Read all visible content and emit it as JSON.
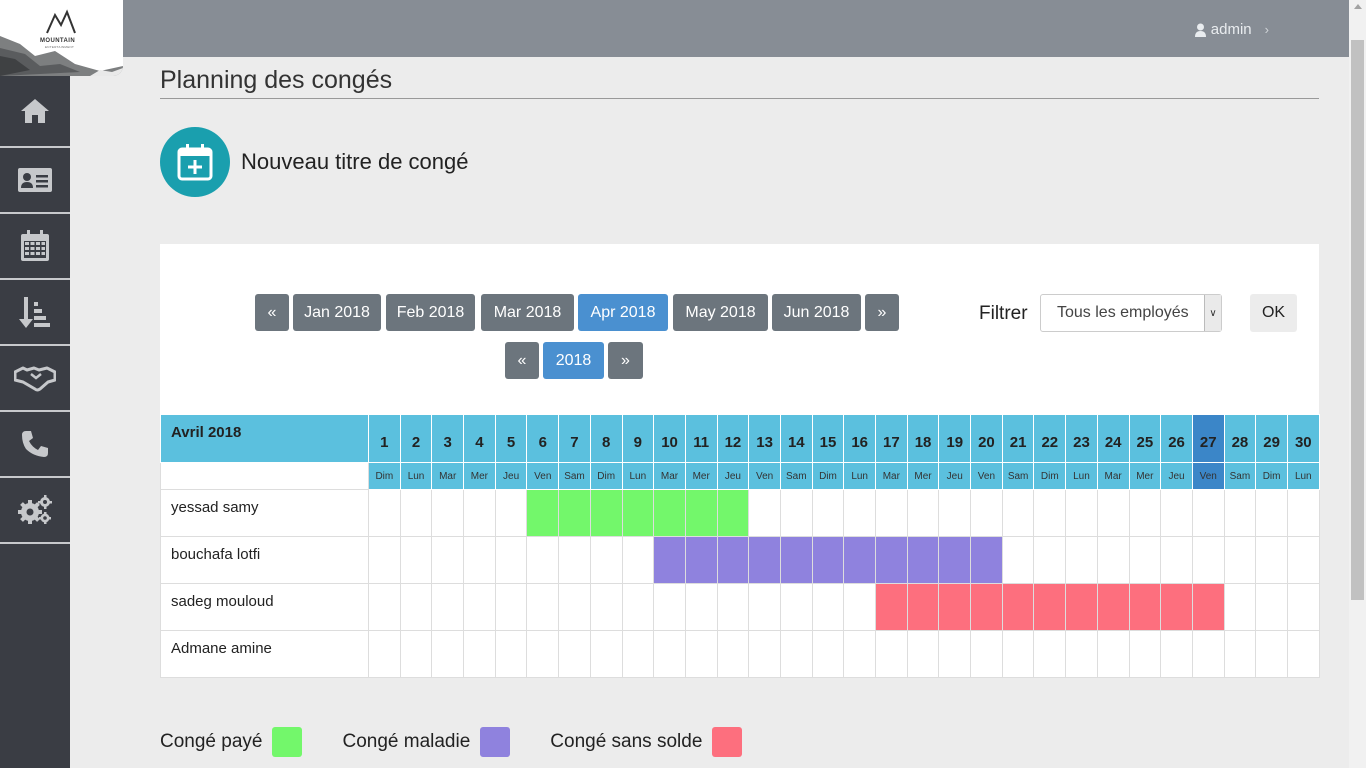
{
  "brand": {
    "name": "MOUNTAIN",
    "tagline": "ENTERTAINMENT"
  },
  "user": {
    "name": "admin"
  },
  "nav": [
    "home-icon",
    "id-card-icon",
    "calendar-icon",
    "sort-icon",
    "handshake-icon",
    "phone-icon",
    "gears-icon"
  ],
  "page": {
    "title": "Planning des congés"
  },
  "new_leave": {
    "label": "Nouveau titre de congé"
  },
  "months": {
    "prev": "«",
    "next": "»",
    "items": [
      "Jan 2018",
      "Feb 2018",
      "Mar 2018",
      "Apr 2018",
      "May 2018",
      "Jun 2018"
    ],
    "active": "Apr 2018"
  },
  "years": {
    "prev": "«",
    "next": "»",
    "value": "2018"
  },
  "filter": {
    "label": "Filtrer",
    "value": "Tous les employés",
    "ok": "OK"
  },
  "calendar": {
    "month_label": "Avril 2018",
    "today": 27,
    "days": [
      {
        "n": "1",
        "d": "Dim"
      },
      {
        "n": "2",
        "d": "Lun"
      },
      {
        "n": "3",
        "d": "Mar"
      },
      {
        "n": "4",
        "d": "Mer"
      },
      {
        "n": "5",
        "d": "Jeu"
      },
      {
        "n": "6",
        "d": "Ven"
      },
      {
        "n": "7",
        "d": "Sam"
      },
      {
        "n": "8",
        "d": "Dim"
      },
      {
        "n": "9",
        "d": "Lun"
      },
      {
        "n": "10",
        "d": "Mar"
      },
      {
        "n": "11",
        "d": "Mer"
      },
      {
        "n": "12",
        "d": "Jeu"
      },
      {
        "n": "13",
        "d": "Ven"
      },
      {
        "n": "14",
        "d": "Sam"
      },
      {
        "n": "15",
        "d": "Dim"
      },
      {
        "n": "16",
        "d": "Lun"
      },
      {
        "n": "17",
        "d": "Mar"
      },
      {
        "n": "18",
        "d": "Mer"
      },
      {
        "n": "19",
        "d": "Jeu"
      },
      {
        "n": "20",
        "d": "Ven"
      },
      {
        "n": "21",
        "d": "Sam"
      },
      {
        "n": "22",
        "d": "Dim"
      },
      {
        "n": "23",
        "d": "Lun"
      },
      {
        "n": "24",
        "d": "Mar"
      },
      {
        "n": "25",
        "d": "Mer"
      },
      {
        "n": "26",
        "d": "Jeu"
      },
      {
        "n": "27",
        "d": "Ven"
      },
      {
        "n": "28",
        "d": "Sam"
      },
      {
        "n": "29",
        "d": "Dim"
      },
      {
        "n": "30",
        "d": "Lun"
      }
    ],
    "employees": [
      {
        "name": "yessad samy",
        "leave": {
          "type": "paye",
          "start": 6,
          "end": 12
        }
      },
      {
        "name": "bouchafa lotfi",
        "leave": {
          "type": "maladie",
          "start": 10,
          "end": 20
        }
      },
      {
        "name": "sadeg mouloud",
        "leave": {
          "type": "sans_solde",
          "start": 17,
          "end": 27
        }
      },
      {
        "name": "Admane amine",
        "leave": null
      }
    ]
  },
  "legend": [
    {
      "key": "paye",
      "label": "Congé payé",
      "color": "#73f76b"
    },
    {
      "key": "maladie",
      "label": "Congé maladie",
      "color": "#8f82de"
    },
    {
      "key": "sans_solde",
      "label": "Congé sans solde",
      "color": "#fd6f7e"
    }
  ]
}
